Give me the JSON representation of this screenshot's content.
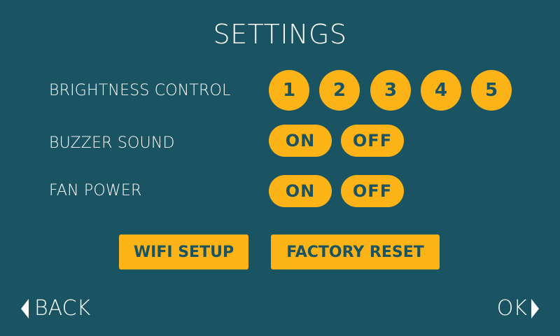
{
  "header": {
    "title": "SETTINGS"
  },
  "brightness": {
    "label": "BRIGHTNESS CONTROL",
    "levels": [
      "1",
      "2",
      "3",
      "4",
      "5"
    ]
  },
  "buzzer": {
    "label": "BUZZER SOUND",
    "on_label": "ON",
    "off_label": "OFF"
  },
  "fan": {
    "label": "FAN POWER",
    "on_label": "ON",
    "off_label": "OFF"
  },
  "actions": {
    "wifi_label": "WIFI SETUP",
    "reset_label": "FACTORY RESET"
  },
  "nav": {
    "back_label": "BACK",
    "ok_label": "OK",
    "back_icon": "triangle-left-icon",
    "ok_icon": "triangle-right-icon"
  },
  "colors": {
    "background": "#1a5462",
    "accent": "#fcb317",
    "text": "#ffffff"
  }
}
